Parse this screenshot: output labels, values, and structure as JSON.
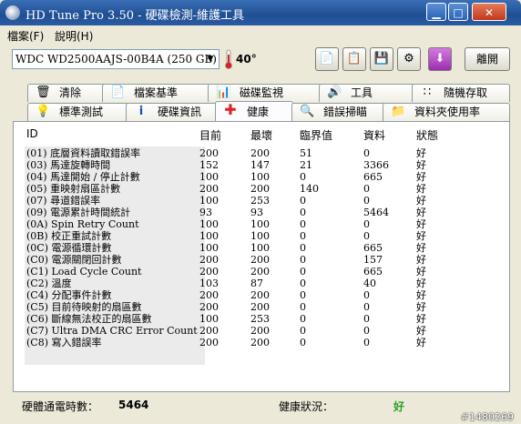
{
  "window": {
    "title": "HD Tune Pro 3.50 - 硬碟檢測-維護工具"
  },
  "menu": [
    "檔案(F)",
    "說明(H)"
  ],
  "toolbar": {
    "drive": "WDC WD2500AAJS-00B4A (250 GB)",
    "temperature": "40°",
    "exit_label": "離開",
    "buttons": [
      "copy-text-icon",
      "copy-screenshot-icon",
      "save-icon",
      "options-icon",
      "download-icon"
    ]
  },
  "tabs_top": [
    {
      "label": "清除",
      "icon": "trash-icon"
    },
    {
      "label": "檔案基準",
      "icon": "file-icon"
    },
    {
      "label": "磁碟監視",
      "icon": "monitor-icon"
    },
    {
      "label": "工具",
      "icon": "speaker-icon"
    },
    {
      "label": "隨機存取",
      "icon": "random-access-icon"
    }
  ],
  "tabs_bottom": [
    {
      "label": "標準測試",
      "icon": "bulb-icon"
    },
    {
      "label": "硬碟資訊",
      "icon": "info-icon"
    },
    {
      "label": "健康",
      "icon": "health-cross-icon",
      "active": true
    },
    {
      "label": "錯誤掃瞄",
      "icon": "magnifier-icon"
    },
    {
      "label": "資料夾使用率",
      "icon": "folder-icon"
    }
  ],
  "table": {
    "headers": [
      "ID",
      "目前",
      "最壞",
      "臨界值",
      "資料",
      "狀態"
    ],
    "rows": [
      [
        "(01) 底層資料讀取錯誤率",
        "200",
        "200",
        "51",
        "0",
        "好"
      ],
      [
        "(03) 馬達旋轉時間",
        "152",
        "147",
        "21",
        "3366",
        "好"
      ],
      [
        "(04) 馬達開始 / 停止計數",
        "100",
        "100",
        "0",
        "665",
        "好"
      ],
      [
        "(05) 重映射扇區計數",
        "200",
        "200",
        "140",
        "0",
        "好"
      ],
      [
        "(07) 尋道錯誤率",
        "100",
        "253",
        "0",
        "0",
        "好"
      ],
      [
        "(09) 電源累計時間統計",
        "93",
        "93",
        "0",
        "5464",
        "好"
      ],
      [
        "(0A) Spin Retry Count",
        "100",
        "100",
        "0",
        "0",
        "好"
      ],
      [
        "(0B) 校正重試計數",
        "100",
        "100",
        "0",
        "0",
        "好"
      ],
      [
        "(0C) 電源循環計數",
        "100",
        "100",
        "0",
        "665",
        "好"
      ],
      [
        "(C0) 電源關閉回計數",
        "200",
        "200",
        "0",
        "157",
        "好"
      ],
      [
        "(C1) Load Cycle Count",
        "200",
        "200",
        "0",
        "665",
        "好"
      ],
      [
        "(C2) 溫度",
        "103",
        "87",
        "0",
        "40",
        "好"
      ],
      [
        "(C4) 分配事件計數",
        "200",
        "200",
        "0",
        "0",
        "好"
      ],
      [
        "(C5) 目前待映射的扇區數",
        "200",
        "200",
        "0",
        "0",
        "好"
      ],
      [
        "(C6) 斷線無法校正的扇區數",
        "100",
        "253",
        "0",
        "0",
        "好"
      ],
      [
        "(C7) Ultra DMA CRC Error Count",
        "200",
        "200",
        "0",
        "0",
        "好"
      ],
      [
        "(C8) 寫入錯誤率",
        "200",
        "200",
        "0",
        "0",
        "好"
      ]
    ]
  },
  "footer": {
    "power_on_label": "硬體通電時數：",
    "power_on_value": "5464",
    "health_label": "健康狀況：",
    "health_value": "好",
    "health_color": "#2aa02a"
  },
  "watermark": "#1480269"
}
